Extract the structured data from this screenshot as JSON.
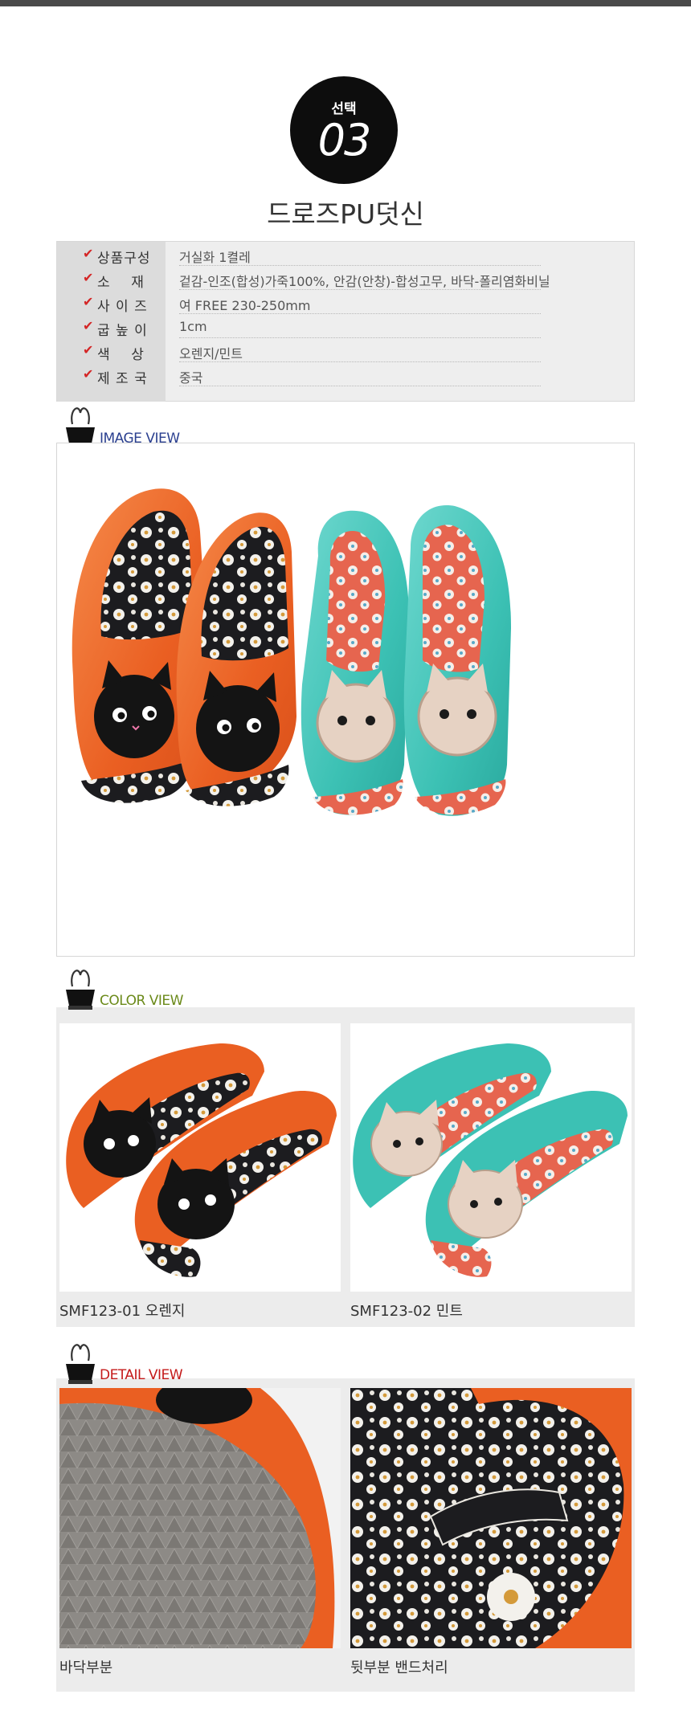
{
  "badge": {
    "label": "선택",
    "number": "03"
  },
  "product_title": "드로즈PU덧신",
  "specs": [
    {
      "label": "상품구성",
      "value": "거실화 1켤레"
    },
    {
      "label": "소    재",
      "value": "겉감-인조(합성)가죽100%, 안감(안창)-합성고무, 바닥-폴리염화비닐"
    },
    {
      "label": "사 이 즈",
      "value": "여 FREE 230-250mm"
    },
    {
      "label": "굽 높 이",
      "value": "1cm"
    },
    {
      "label": "색    상",
      "value": "오렌지/민트"
    },
    {
      "label": "제 조 국",
      "value": "중국"
    }
  ],
  "check_mark": "✔",
  "sections": {
    "image_view": {
      "title": "IMAGE VIEW",
      "color": "#2a3f8f"
    },
    "color_view": {
      "title": "COLOR VIEW",
      "color": "#6b8a1a"
    },
    "detail_view": {
      "title": "DETAIL VIEW",
      "color": "#c41a1a"
    }
  },
  "color_items": [
    {
      "caption": "SMF123-01 오렌지"
    },
    {
      "caption": "SMF123-02 민트"
    }
  ],
  "detail_items": [
    {
      "caption": "바닥부분"
    },
    {
      "caption": "뒷부분 밴드처리"
    }
  ],
  "colors": {
    "orange": "#ef6a2c",
    "mint": "#3fc4b8",
    "check": "#d42626",
    "panel": "#ececec"
  }
}
